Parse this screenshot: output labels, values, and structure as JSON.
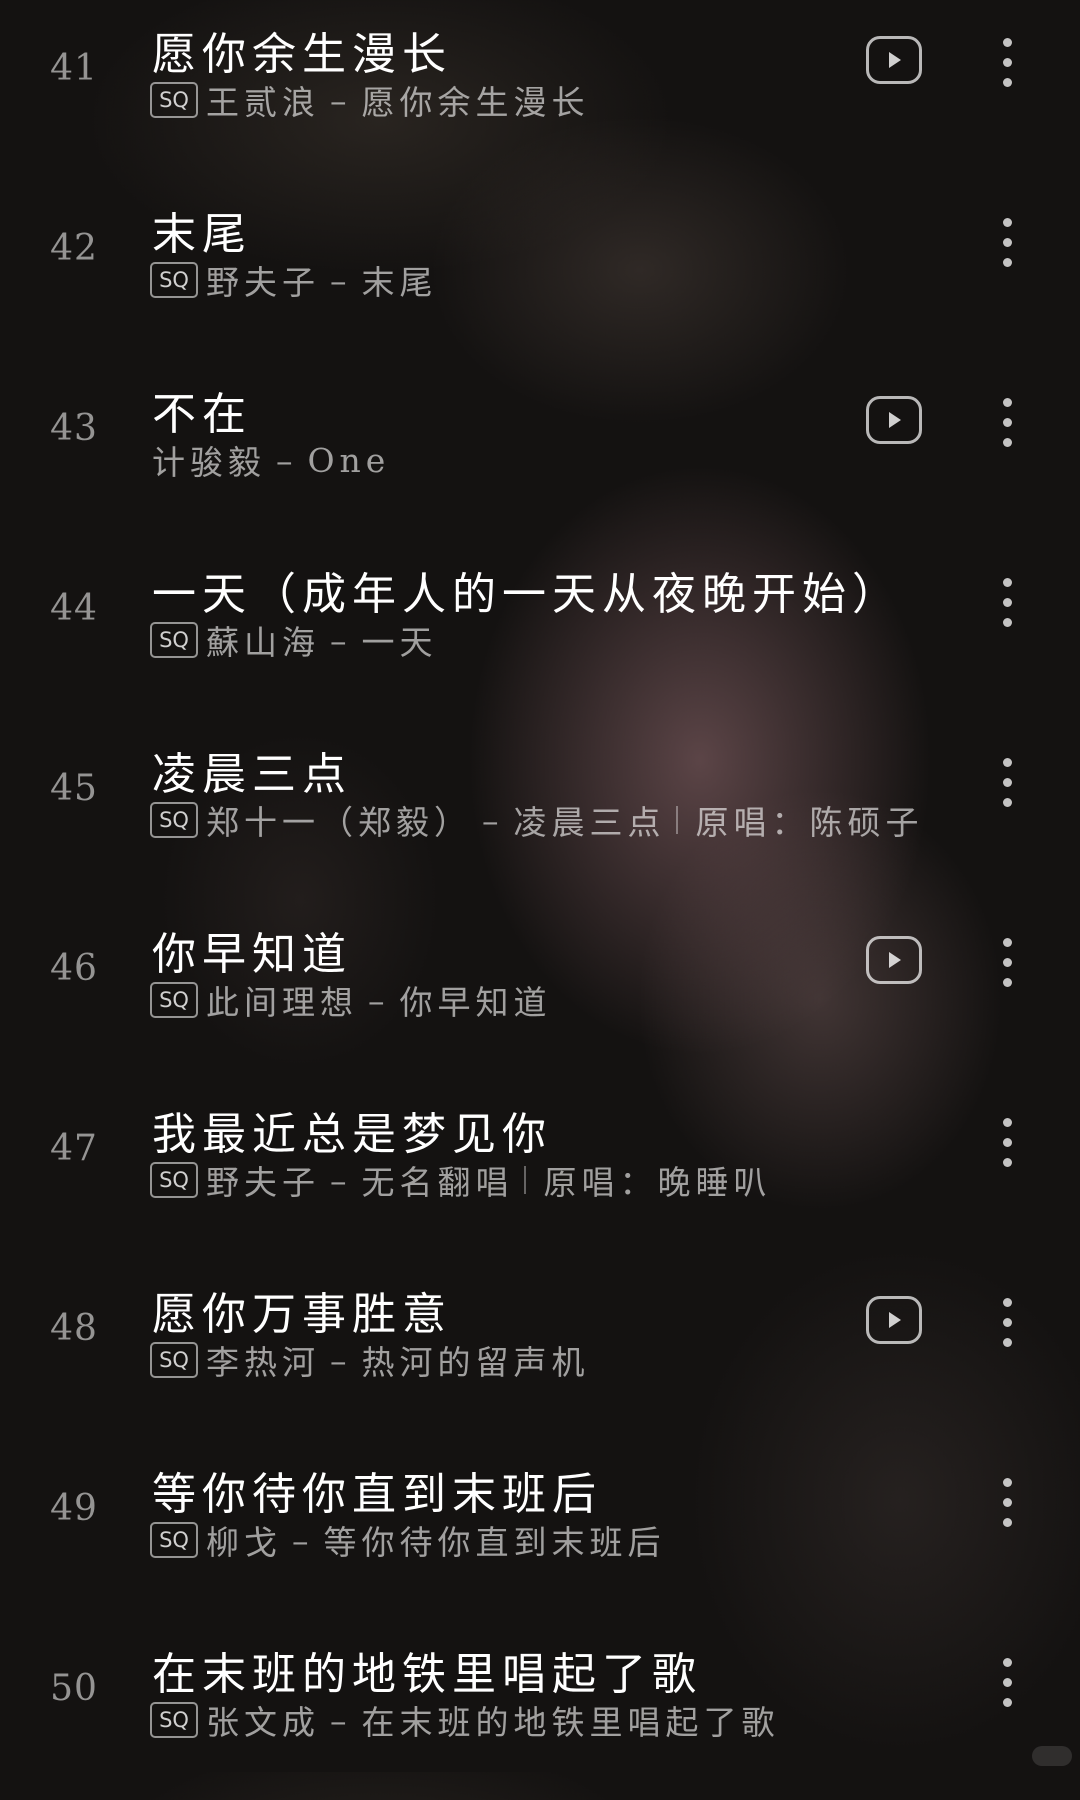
{
  "songs": [
    {
      "num": "41",
      "title": "愿你余生漫长",
      "sq": true,
      "artist": "王贰浪",
      "album": "愿你余生漫长",
      "original": "",
      "mv": true
    },
    {
      "num": "42",
      "title": "末尾",
      "sq": true,
      "artist": "野夫子",
      "album": "末尾",
      "original": "",
      "mv": false
    },
    {
      "num": "43",
      "title": "不在",
      "sq": false,
      "artist": "计骏毅",
      "album": "One",
      "original": "",
      "mv": true
    },
    {
      "num": "44",
      "title": "一天（成年人的一天从夜晚开始）",
      "sq": true,
      "artist": "蘇山海",
      "album": "一天",
      "original": "",
      "mv": false
    },
    {
      "num": "45",
      "title": "凌晨三点",
      "sq": true,
      "artist": "郑十一（郑毅）",
      "album": "凌晨三点",
      "original": "原唱：陈硕子",
      "mv": false
    },
    {
      "num": "46",
      "title": "你早知道",
      "sq": true,
      "artist": "此间理想",
      "album": "你早知道",
      "original": "",
      "mv": true
    },
    {
      "num": "47",
      "title": "我最近总是梦见你",
      "sq": true,
      "artist": "野夫子",
      "album": "无名翻唱",
      "original": "原唱：晚睡叭",
      "mv": false
    },
    {
      "num": "48",
      "title": "愿你万事胜意",
      "sq": true,
      "artist": "李热河",
      "album": "热河的留声机",
      "original": "",
      "mv": true
    },
    {
      "num": "49",
      "title": "等你待你直到末班后",
      "sq": true,
      "artist": "柳戈",
      "album": "等你待你直到末班后",
      "original": "",
      "mv": false
    },
    {
      "num": "50",
      "title": "在末班的地铁里唱起了歌",
      "sq": true,
      "artist": "张文成",
      "album": "在末班的地铁里唱起了歌",
      "original": "",
      "mv": false
    }
  ],
  "labels": {
    "sq_badge": "SQ",
    "separator": "–"
  },
  "icons": {
    "mv": "play-video-icon",
    "more": "more-vertical-icon"
  },
  "colors": {
    "background": "#141211",
    "title_text": "#ffffff",
    "secondary_text": "#999999"
  }
}
